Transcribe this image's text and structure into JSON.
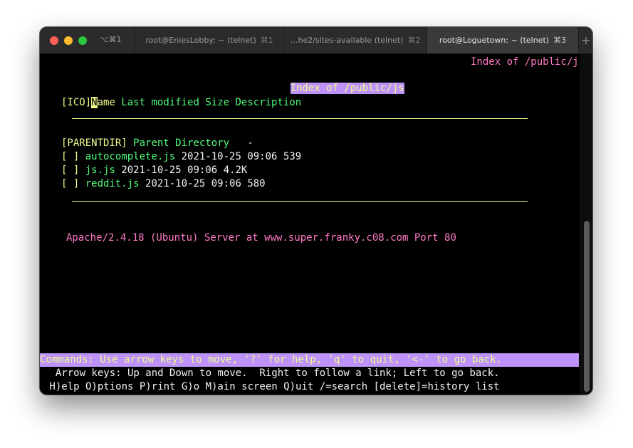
{
  "titlebar": {
    "shortcut": "⌥⌘1",
    "tabs": [
      {
        "title": "root@EniesLobby: ~ (telnet)",
        "shortcut": "⌘1",
        "active": false
      },
      {
        "title": "…he2/sites-available (telnet)",
        "shortcut": "⌘2",
        "active": false
      },
      {
        "title": "root@Loguetown: ~ (telnet)",
        "shortcut": "⌘3",
        "active": true
      }
    ],
    "add_tab": "+"
  },
  "terminal": {
    "header_right": "Index of /public/js",
    "heading": "Index of /public/js",
    "columns": {
      "ico": "[ICO]",
      "name_cursor": "N",
      "name_rest": "ame",
      "rest": "Last modified Size Description"
    },
    "parent": {
      "icon": "[PARENTDIR]",
      "name": "Parent Directory",
      "size": "-"
    },
    "files": [
      {
        "icon": "[ ]",
        "name": "autocomplete.js",
        "modified": "2021-10-25 09:06",
        "size": "539"
      },
      {
        "icon": "[ ]",
        "name": "js.js",
        "modified": "2021-10-25 09:06",
        "size": "4.2K"
      },
      {
        "icon": "[ ]",
        "name": "reddit.js",
        "modified": "2021-10-25 09:06",
        "size": "580"
      }
    ],
    "server_signature": "Apache/2.4.18 (Ubuntu) Server at www.super.franky.c08.com Port 80",
    "commands": "Commands: Use arrow keys to move, '?' for help, 'q' to quit, '<-' to go back.",
    "arrow_help": "  Arrow keys: Up and Down to move.  Right to follow a link; Left to go back.",
    "key_help": " H)elp O)ptions P)rint G)o M)ain screen Q)uit /=search [delete]=history list"
  },
  "colors": {
    "link": "#50fa7b",
    "accent_pink": "#ff79c6",
    "highlight": "#bd93f9",
    "text_yellow": "#f1fa8c"
  }
}
